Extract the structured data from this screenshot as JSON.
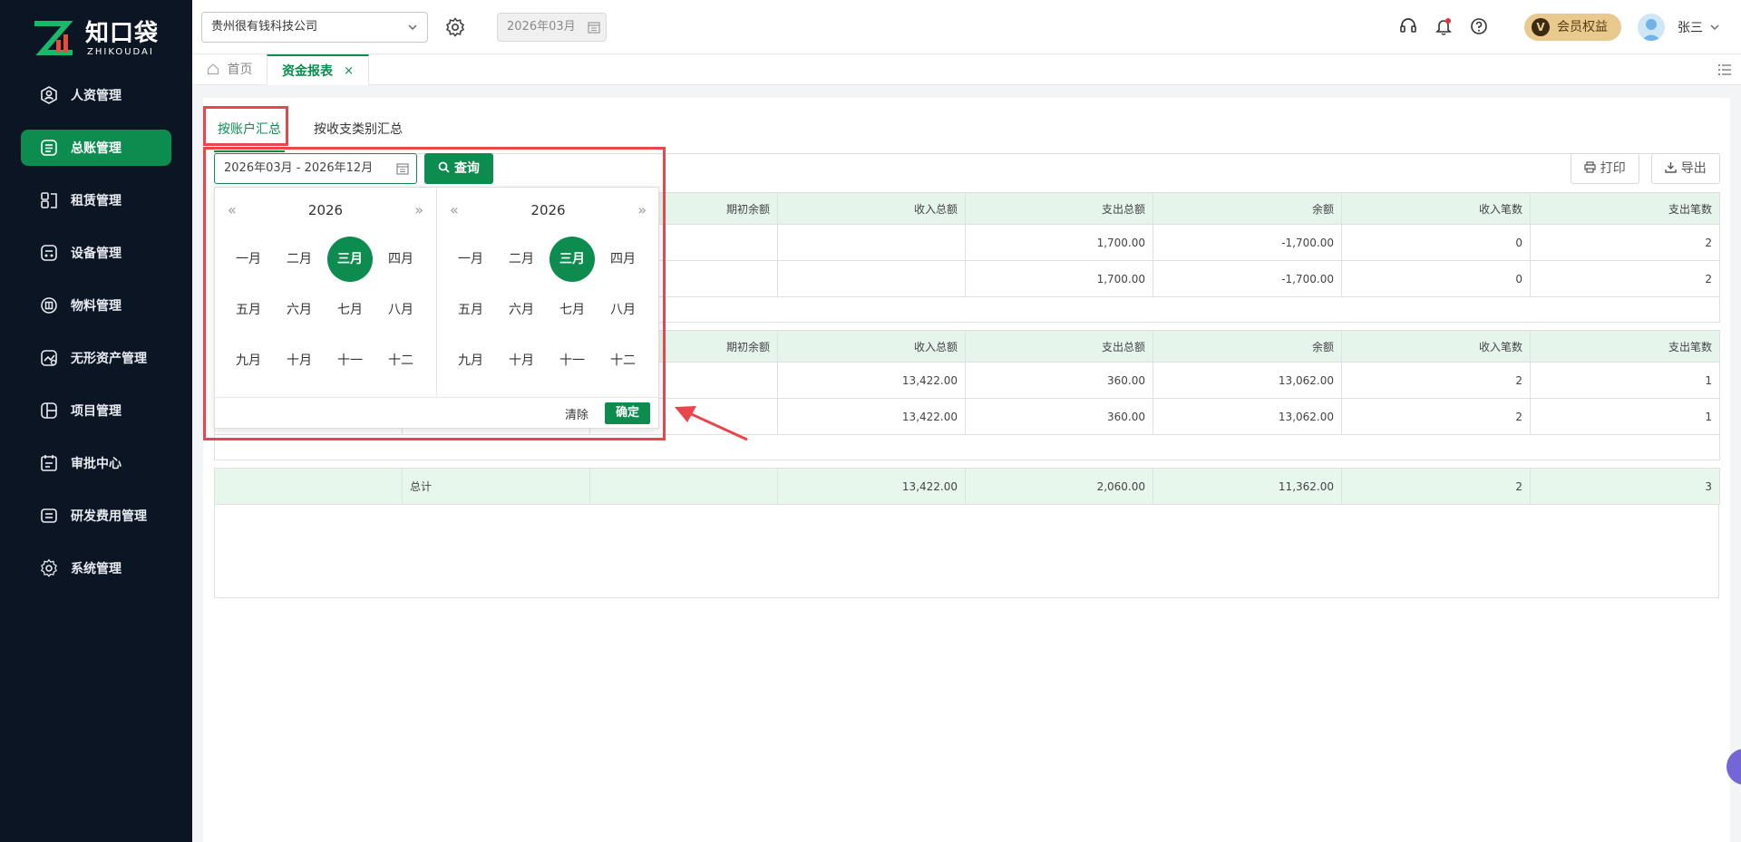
{
  "brand": {
    "name": "知口袋",
    "sub": "ZHIKOUDAI"
  },
  "sidebar": {
    "items": [
      {
        "label": "人资管理",
        "icon": "person-icon",
        "active": false
      },
      {
        "label": "总账管理",
        "icon": "ledger-icon",
        "active": true
      },
      {
        "label": "租赁管理",
        "icon": "lease-icon",
        "active": false
      },
      {
        "label": "设备管理",
        "icon": "device-icon",
        "active": false
      },
      {
        "label": "物料管理",
        "icon": "material-icon",
        "active": false
      },
      {
        "label": "无形资产管理",
        "icon": "asset-icon",
        "active": false
      },
      {
        "label": "项目管理",
        "icon": "project-icon",
        "active": false
      },
      {
        "label": "审批中心",
        "icon": "approval-icon",
        "active": false
      },
      {
        "label": "研发费用管理",
        "icon": "rd-icon",
        "active": false
      },
      {
        "label": "系统管理",
        "icon": "gear-icon",
        "active": false
      }
    ]
  },
  "header": {
    "company": "贵州很有钱科技公司",
    "period": "2026年03月",
    "vip_label": "会员权益",
    "vip_badge": "V",
    "user": "张三"
  },
  "tabs": {
    "home": "首页",
    "active": "资金报表",
    "close": "×"
  },
  "subtabs": {
    "by_account": "按账户汇总",
    "by_category": "按收支类别汇总"
  },
  "toolbar": {
    "date_range": "2026年03月 - 2026年12月",
    "query": "查询",
    "print": "打印",
    "export": "导出"
  },
  "picker": {
    "left": {
      "year": "2026"
    },
    "right": {
      "year": "2026"
    },
    "months": [
      "一月",
      "二月",
      "三月",
      "四月",
      "五月",
      "六月",
      "七月",
      "八月",
      "九月",
      "十月",
      "十一",
      "十二"
    ],
    "selected_month_index": 2,
    "clear": "清除",
    "confirm": "确定"
  },
  "table": {
    "columns": [
      "期初余额",
      "收入总额",
      "支出总额",
      "余额",
      "收入笔数",
      "支出笔数"
    ],
    "group1": [
      {
        "opening": "",
        "income": "",
        "expense": "1,700.00",
        "balance": "-1,700.00",
        "income_count": "0",
        "expense_count": "2"
      },
      {
        "opening": "",
        "income": "",
        "expense": "1,700.00",
        "balance": "-1,700.00",
        "income_count": "0",
        "expense_count": "2"
      }
    ],
    "group2": [
      {
        "opening": "",
        "income": "13,422.00",
        "expense": "360.00",
        "balance": "13,062.00",
        "income_count": "2",
        "expense_count": "1"
      },
      {
        "opening": "",
        "income": "13,422.00",
        "expense": "360.00",
        "balance": "13,062.00",
        "income_count": "2",
        "expense_count": "1"
      }
    ],
    "total": {
      "label": "总计",
      "opening": "",
      "income": "13,422.00",
      "expense": "2,060.00",
      "balance": "11,362.00",
      "income_count": "2",
      "expense_count": "3"
    }
  },
  "colors": {
    "accent": "#0d8c50",
    "annotation": "#e8464b",
    "sidebar_bg": "#0c1524",
    "header_bg": "#e5f5ec"
  }
}
